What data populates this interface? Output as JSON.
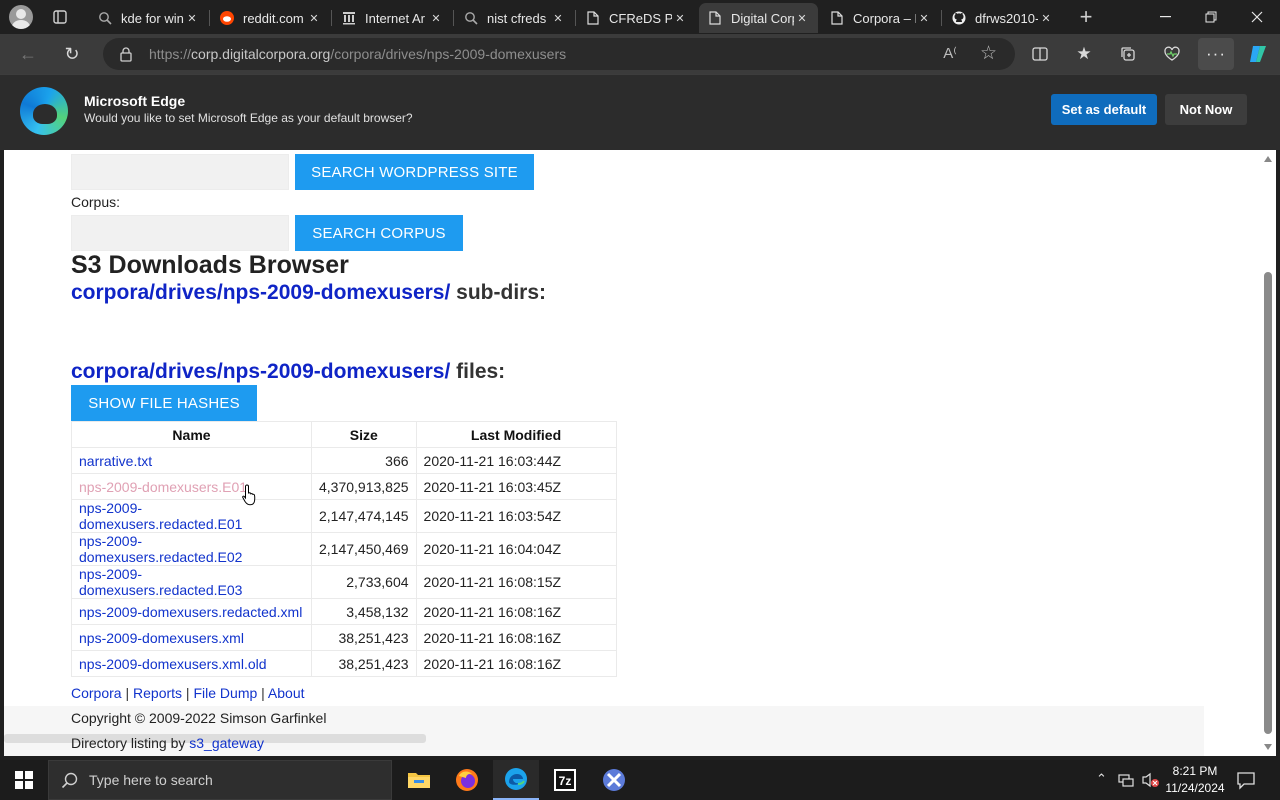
{
  "browser": {
    "tabs": [
      {
        "title": "kde for win",
        "favicon": "search-icon",
        "active": false
      },
      {
        "title": "reddit.com",
        "favicon": "reddit-icon",
        "active": false
      },
      {
        "title": "Internet Ar",
        "favicon": "archive-icon",
        "active": false
      },
      {
        "title": "nist cfreds",
        "favicon": "search-icon",
        "active": false
      },
      {
        "title": "CFReDS Por",
        "favicon": "page-icon",
        "active": false
      },
      {
        "title": "Digital Corp",
        "favicon": "page-icon",
        "active": true
      },
      {
        "title": "Corpora – I",
        "favicon": "page-icon",
        "active": false
      },
      {
        "title": "dfrws2010-",
        "favicon": "github-icon",
        "active": false
      }
    ],
    "new_tab": "+",
    "address": {
      "scheme": "https://",
      "host": "corp.digitalcorpora.org",
      "path": "/corpora/drives/nps-2009-domexusers"
    }
  },
  "banner": {
    "title": "Microsoft Edge",
    "message": "Would you like to set Microsoft Edge as your default browser?",
    "set_default": "Set as default",
    "not_now": "Not Now"
  },
  "page": {
    "search_wp_button": "SEARCH WORDPRESS SITE",
    "corpus_label": "Corpus:",
    "search_corpus_button": "SEARCH CORPUS",
    "s3_title": "S3 Downloads Browser",
    "subdirs_link": "corpora/drives/nps-2009-domexusers/",
    "subdirs_suffix": " sub-dirs:",
    "files_link": "corpora/drives/nps-2009-domexusers/",
    "files_suffix": " files:",
    "show_hashes_button": "SHOW FILE HASHES",
    "table": {
      "headers": [
        "Name",
        "Size",
        "Last Modified"
      ],
      "rows": [
        {
          "name": "narrative.txt",
          "size": "366",
          "modified": "2020-11-21 16:03:44Z"
        },
        {
          "name": "nps-2009-domexusers.E01",
          "size": "4,370,913,825",
          "modified": "2020-11-21 16:03:45Z"
        },
        {
          "name": "nps-2009-domexusers.redacted.E01",
          "size": "2,147,474,145",
          "modified": "2020-11-21 16:03:54Z"
        },
        {
          "name": "nps-2009-domexusers.redacted.E02",
          "size": "2,147,450,469",
          "modified": "2020-11-21 16:04:04Z"
        },
        {
          "name": "nps-2009-domexusers.redacted.E03",
          "size": "2,733,604",
          "modified": "2020-11-21 16:08:15Z"
        },
        {
          "name": "nps-2009-domexusers.redacted.xml",
          "size": "3,458,132",
          "modified": "2020-11-21 16:08:16Z"
        },
        {
          "name": "nps-2009-domexusers.xml",
          "size": "38,251,423",
          "modified": "2020-11-21 16:08:16Z"
        },
        {
          "name": "nps-2009-domexusers.xml.old",
          "size": "38,251,423",
          "modified": "2020-11-21 16:08:16Z"
        }
      ]
    },
    "footer_links": [
      "Corpora",
      "Reports",
      "File Dump",
      "About"
    ],
    "footer_sep": " | ",
    "copyright": "Copyright © 2009-2022 Simson Garfinkel",
    "dir_listing_prefix": "Directory listing by ",
    "dir_listing_link": "s3_gateway"
  },
  "taskbar": {
    "search_placeholder": "Type here to search",
    "time": "8:21 PM",
    "date": "11/24/2024",
    "apps": [
      "file-explorer-icon",
      "firefox-icon",
      "edge-icon",
      "7zip-icon",
      "app-icon"
    ]
  },
  "colors": {
    "link": "#1133cc",
    "visited": "#e0a1b4",
    "button_blue": "#1e9bf0",
    "edge_primary": "#0f6cbd"
  }
}
